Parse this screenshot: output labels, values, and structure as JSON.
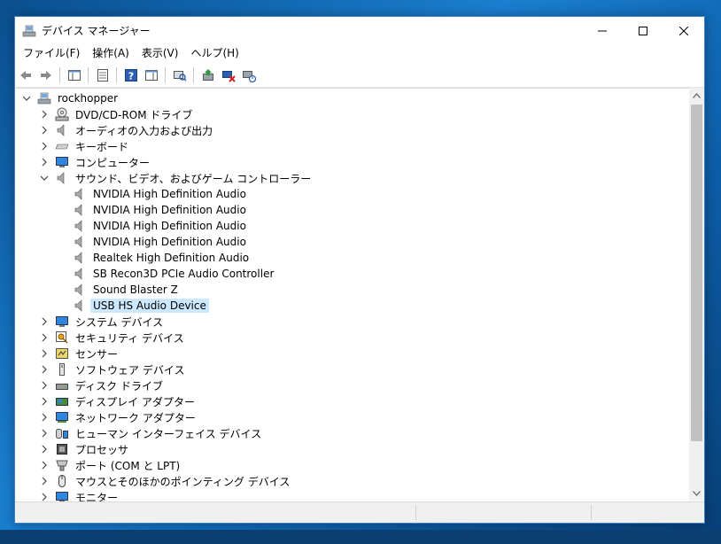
{
  "window": {
    "title": "デバイス マネージャー"
  },
  "menu": [
    "ファイル(F)",
    "操作(A)",
    "表示(V)",
    "ヘルプ(H)"
  ],
  "tree": {
    "root": "rockhopper",
    "categories": [
      {
        "label": "DVD/CD-ROM ドライブ",
        "icon": "dvd-drive-icon",
        "expanded": false
      },
      {
        "label": "オーディオの入力および出力",
        "icon": "speaker-icon",
        "expanded": false
      },
      {
        "label": "キーボード",
        "icon": "keyboard-icon",
        "expanded": false
      },
      {
        "label": "コンピューター",
        "icon": "computer-icon",
        "expanded": false
      },
      {
        "label": "サウンド、ビデオ、およびゲーム コントローラー",
        "icon": "speaker-icon",
        "expanded": true,
        "children": [
          "NVIDIA High Definition Audio",
          "NVIDIA High Definition Audio",
          "NVIDIA High Definition Audio",
          "NVIDIA High Definition Audio",
          "Realtek High Definition Audio",
          "SB Recon3D PCIe Audio Controller",
          "Sound Blaster Z",
          "USB HS Audio Device"
        ],
        "selected_child": 7
      },
      {
        "label": "システム デバイス",
        "icon": "monitor-icon",
        "expanded": false
      },
      {
        "label": "セキュリティ デバイス",
        "icon": "security-key-icon",
        "expanded": false
      },
      {
        "label": "センサー",
        "icon": "sensor-icon",
        "expanded": false
      },
      {
        "label": "ソフトウェア デバイス",
        "icon": "software-device-icon",
        "expanded": false
      },
      {
        "label": "ディスク ドライブ",
        "icon": "disk-drive-icon",
        "expanded": false
      },
      {
        "label": "ディスプレイ アダプター",
        "icon": "display-adapter-icon",
        "expanded": false
      },
      {
        "label": "ネットワーク アダプター",
        "icon": "network-adapter-icon",
        "expanded": false
      },
      {
        "label": "ヒューマン インターフェイス デバイス",
        "icon": "hid-icon",
        "expanded": false
      },
      {
        "label": "プロセッサ",
        "icon": "processor-icon",
        "expanded": false
      },
      {
        "label": "ポート (COM と LPT)",
        "icon": "port-icon",
        "expanded": false
      },
      {
        "label": "マウスとそのほかのポインティング デバイス",
        "icon": "mouse-icon",
        "expanded": false
      },
      {
        "label": "モニター",
        "icon": "monitor-icon",
        "expanded": false
      }
    ]
  }
}
